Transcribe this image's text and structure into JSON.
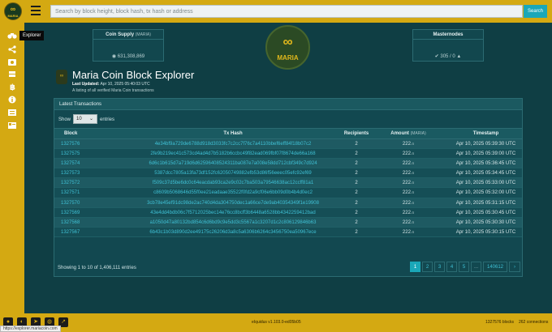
{
  "header": {
    "logo_symbol": "∞",
    "logo_name": "MARIA",
    "search_placeholder": "Search by block height, block hash, tx hash or address",
    "search_button": "Search"
  },
  "sidebar": {
    "items": [
      {
        "icon": "explorer-icon",
        "label": "Explorer"
      },
      {
        "icon": "network-icon"
      },
      {
        "icon": "movement-icon"
      },
      {
        "icon": "masternode-icon"
      },
      {
        "icon": "bitcoin-markets-icon"
      },
      {
        "icon": "info-icon"
      },
      {
        "icon": "richlist-icon"
      },
      {
        "icon": "api-icon"
      }
    ],
    "tooltip": "Explorer"
  },
  "cards": {
    "supply": {
      "title": "Coin Supply",
      "unit": "(MARIA)",
      "value": "631,308,869"
    },
    "masternodes": {
      "title": "Masternodes",
      "value": "305 / 0"
    }
  },
  "page": {
    "title": "Maria Coin Block Explorer",
    "updated_label": "Last Updated:",
    "updated_value": "Apr 10, 2025 05:40:03 UTC",
    "subtitle": "A listing of all verified Maria Coin transactions"
  },
  "table": {
    "panel_title": "Latest Transactions",
    "show_label": "Show",
    "show_value": "10",
    "entries_label": "entries",
    "columns": {
      "block": "Block",
      "hash": "Tx Hash",
      "recipients": "Recipients",
      "amount": "Amount",
      "amount_unit": "(MARIA)",
      "timestamp": "Timestamp"
    },
    "rows": [
      {
        "block": "1327576",
        "hash": "4e34bf9a729de6788d918d3033fc7c2cc7f76c7a4110bbef6eff84f18b07c2",
        "recipients": "2",
        "amount": "222",
        "amount_dec": ".a",
        "timestamp": "Apr 10, 2025 05:39:30 UTC"
      },
      {
        "block": "1327575",
        "hash": "2fe9b219ec41c573cd4ad4d7b5182b6ccbc49f82ead069fbf07f8674de66a168",
        "recipients": "2",
        "amount": "222",
        "amount_dec": ".a",
        "timestamp": "Apr 10, 2025 05:39:00 UTC"
      },
      {
        "block": "1327574",
        "hash": "6d6c1b615d7a719d6d62596408524311ba087e7a008e58dd712cbf349c7d924",
        "recipients": "2",
        "amount": "222",
        "amount_dec": ".a",
        "timestamp": "Apr 10, 2025 05:36:45 UTC"
      },
      {
        "block": "1327573",
        "hash": "5387dcc7805a13fa73df152fc62050749882efb53d86f56eeec05efc92ef69",
        "recipients": "2",
        "amount": "222",
        "amount_dec": ".a",
        "timestamp": "Apr 10, 2025 05:34:45 UTC"
      },
      {
        "block": "1327572",
        "hash": "f509c37d5be6dc0c64eacdab93ca2e9c02c7ba503a79546638ac12ccff81a1",
        "recipients": "2",
        "amount": "222",
        "amount_dec": ".a",
        "timestamp": "Apr 10, 2025 05:33:00 UTC"
      },
      {
        "block": "1327571",
        "hash": "c8609b5068646d55f0ee21eadaae35522f0fd2a9cf06e6bb09d0b4b4d0ec2",
        "recipients": "2",
        "amount": "222",
        "amount_dec": ".a",
        "timestamp": "Apr 10, 2025 05:32:00 UTC"
      },
      {
        "block": "1327570",
        "hash": "3cb78e45ef91dc98de2ac740d4da304750dec1a66ce7de9ab40354349f1e19908",
        "recipients": "2",
        "amount": "222",
        "amount_dec": ".a",
        "timestamp": "Apr 10, 2025 05:31:15 UTC"
      },
      {
        "block": "1327569",
        "hash": "43e4dd4bdb06c7f5712025bec14e76cc8bcff3b6448a6528bb4342259412bad",
        "recipients": "2",
        "amount": "222",
        "amount_dec": ".a",
        "timestamp": "Apr 10, 2025 05:30:45 UTC"
      },
      {
        "block": "1327568",
        "hash": "a1050d47a80132bd854c6d6bd9c9e5dd3c5567a1c3207d1c2c806129846b63",
        "recipients": "2",
        "amount": "222",
        "amount_dec": ".a",
        "timestamp": "Apr 10, 2025 05:30:30 UTC"
      },
      {
        "block": "1327567",
        "hash": "6b43c1b03d890d2ee49175c26206d3a8c5a6306b6264c3456750ea50967ece",
        "recipients": "2",
        "amount": "222",
        "amount_dec": ".a",
        "timestamp": "Apr 10, 2025 05:30:15 UTC"
      }
    ],
    "showing": "Showing 1 to 10 of 1,406,111 entries",
    "pages": [
      "1",
      "2",
      "3",
      "4",
      "5",
      "...",
      "140612",
      "›"
    ],
    "active_page": "1"
  },
  "footer": {
    "version": "eIquidus v1.103.0-ed05b05",
    "blocks": "1327576 blocks",
    "connections": "262 connections",
    "icons": [
      "github-icon",
      "discord-icon",
      "telegram-icon",
      "coingecko-icon",
      "external-link-icon"
    ]
  },
  "statusbar": {
    "url": "https://explorer.mariacoin.com"
  },
  "colors": {
    "accent": "#d4a912",
    "background": "#0f3e44",
    "link": "#3fc0d4",
    "button": "#1aa7b8"
  }
}
